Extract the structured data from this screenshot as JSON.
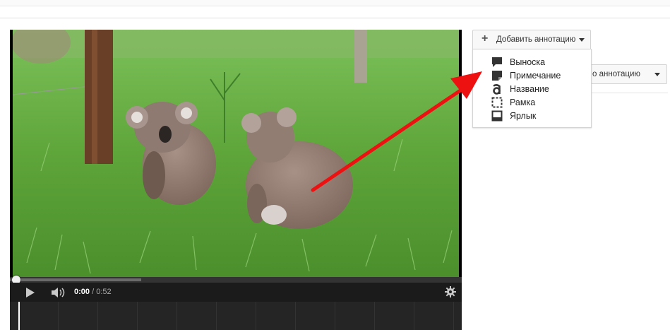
{
  "player": {
    "time_current": "0:00",
    "time_separator": "/",
    "time_total": "0:52",
    "progress_fraction": 0.29
  },
  "annotations": {
    "add_button_label": "Добавить аннотацию",
    "menu": [
      {
        "label": "Выноска",
        "icon": "speech-bubble-icon"
      },
      {
        "label": "Примечание",
        "icon": "note-icon"
      },
      {
        "label": "Название",
        "icon": "title-letter-a-icon"
      },
      {
        "label": "Рамка",
        "icon": "spotlight-frame-icon"
      },
      {
        "label": "Ярлык",
        "icon": "label-icon"
      }
    ],
    "partial_select_label": "о аннотацию"
  },
  "colors": {
    "arrow": "#ee1111",
    "grass": "#5ea53a",
    "controls_bg": "#1b1b1b"
  }
}
